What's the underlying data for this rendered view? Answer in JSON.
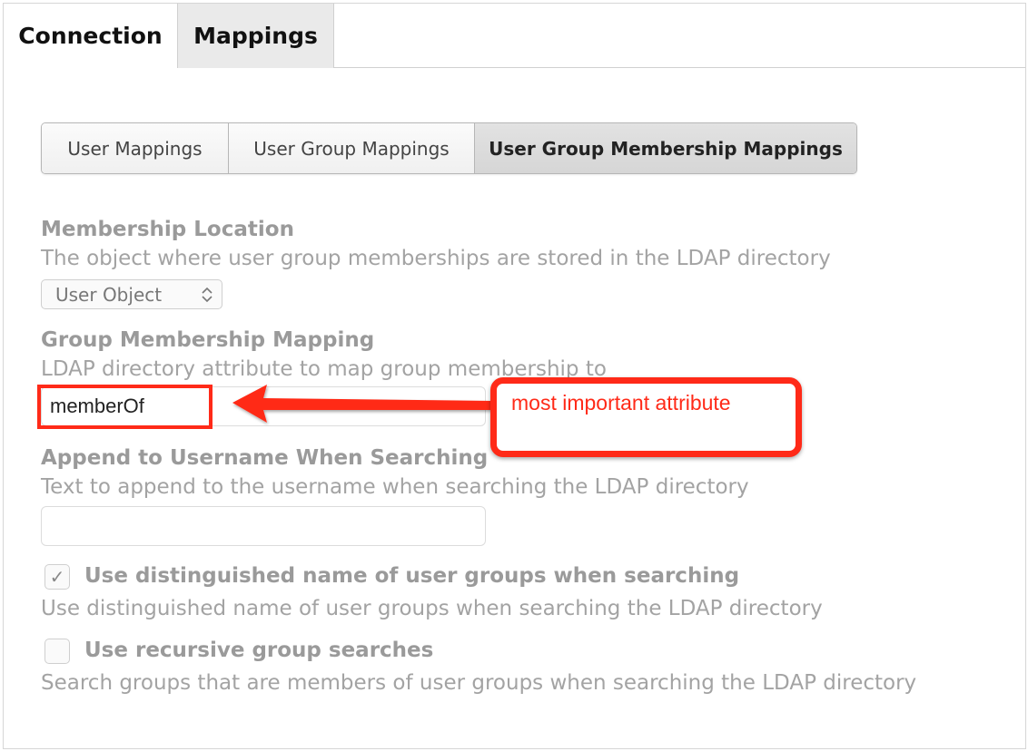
{
  "top_tabs": {
    "connection": "Connection",
    "mappings": "Mappings"
  },
  "sub_tabs": {
    "user_mappings": "User Mappings",
    "user_group_mappings": "User Group Mappings",
    "user_group_membership_mappings": "User Group Membership Mappings"
  },
  "membership_location": {
    "label": "Membership Location",
    "description": "The object where user group memberships are stored in the LDAP directory",
    "selected": "User Object"
  },
  "group_membership_mapping": {
    "label": "Group Membership Mapping",
    "description": "LDAP directory attribute to map group membership to",
    "value": "memberOf"
  },
  "annotation": {
    "text": "most important attribute",
    "color": "#ff2a18"
  },
  "append_username": {
    "label": "Append to Username When Searching",
    "description": "Text to append to the username when searching the LDAP directory",
    "value": ""
  },
  "use_dn": {
    "label": "Use distinguished name of user groups when searching",
    "description": "Use distinguished name of user groups when searching the LDAP directory",
    "checked": true,
    "check_glyph": "✓"
  },
  "recursive": {
    "label": "Use recursive group searches",
    "description": "Search groups that are members of user groups when searching the LDAP directory",
    "checked": false
  }
}
